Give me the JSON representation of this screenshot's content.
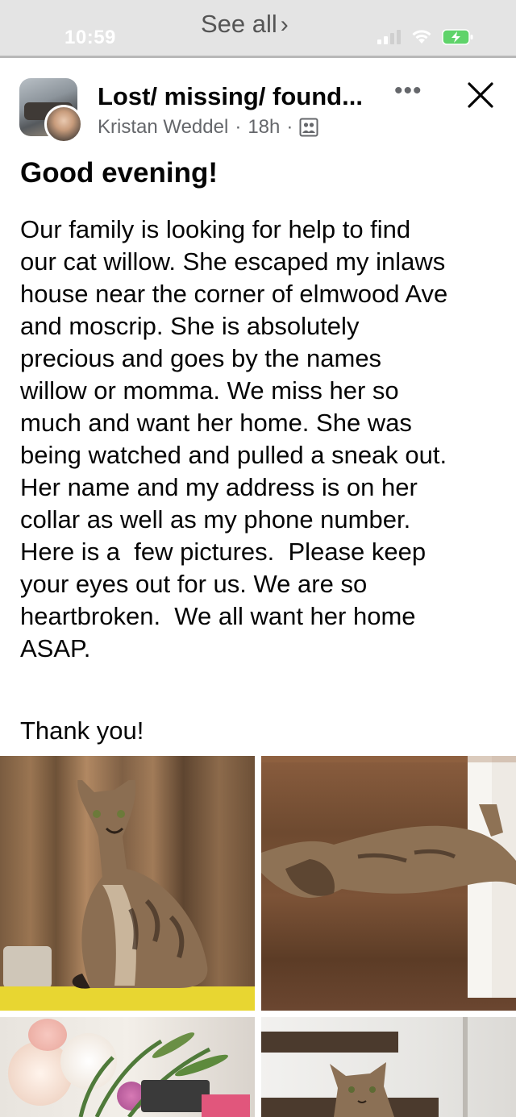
{
  "status_bar": {
    "time": "10:59",
    "back_label": "See all",
    "icons": [
      "cellular-signal-icon",
      "wifi-icon",
      "battery-charging-icon"
    ]
  },
  "post": {
    "group_name": "Lost/ missing/ found...",
    "author": "Kristan Weddel",
    "separator": "·",
    "time_ago": "18h",
    "audience_icon": "group-members-icon",
    "more_label": "•••",
    "title": "Good evening!",
    "message": "Our family is looking for help to find\nour cat willow. She escaped my inlaws\nhouse near the corner of elmwood Ave\nand moscrip. She is absolutely\nprecious and goes by the names\nwillow or momma. We miss her so\nmuch and want her home. She was\nbeing watched and pulled a sneak out.\nHer name and my address is on her\ncollar as well as my phone number.\nHere is a  few pictures.  Please keep\nyour eyes out for us. We are so\nheartbroken.  We all want her home\nASAP.",
    "closing": "Thank you!"
  },
  "colors": {
    "text": "#050505",
    "secondary_text": "#65676b",
    "banner_bg": "#e4e4e4",
    "battery_green": "#5fd36a"
  }
}
